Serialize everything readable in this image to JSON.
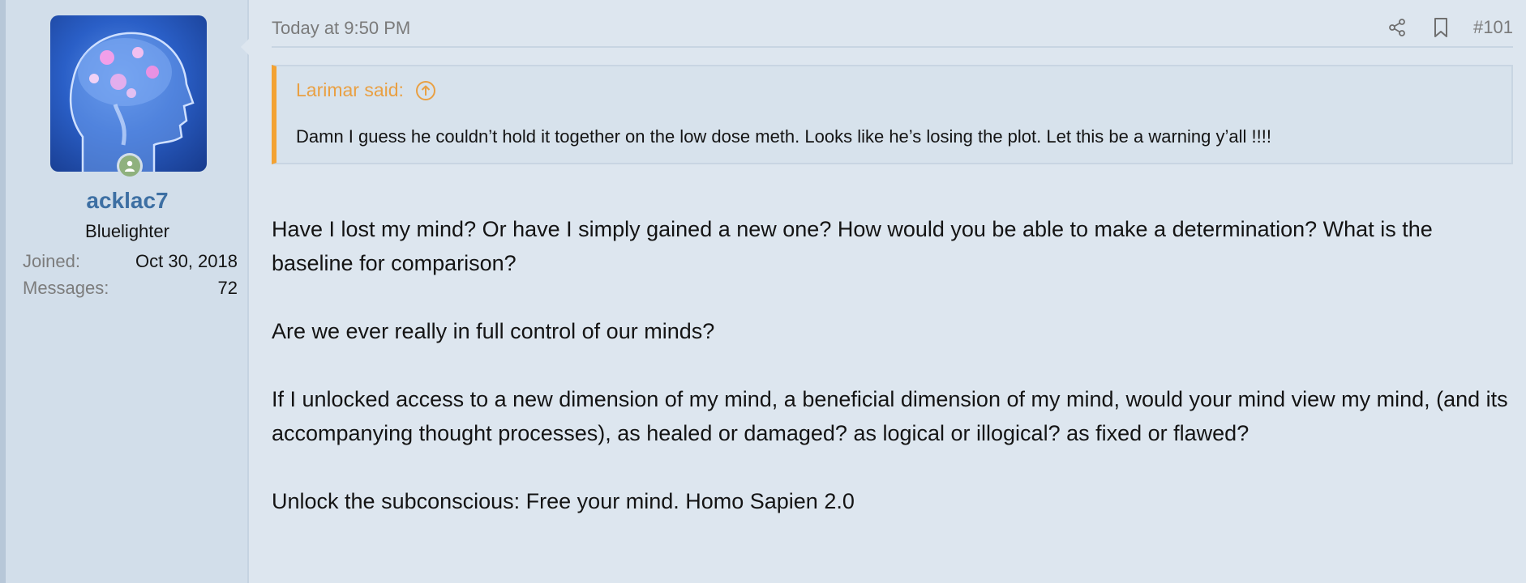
{
  "user": {
    "name": "acklac7",
    "title": "Bluelighter",
    "stats": [
      {
        "key": "Joined:",
        "value": "Oct 30, 2018"
      },
      {
        "key": "Messages:",
        "value": "72"
      }
    ],
    "avatar_icon": "brain-avatar-icon",
    "online_icon": "user-online-icon"
  },
  "post": {
    "date": "Today at 9:50 PM",
    "number": "#101",
    "share_icon": "share-icon",
    "bookmark_icon": "bookmark-icon"
  },
  "quote": {
    "author": "Larimar said:",
    "text": "Damn I guess he couldn’t hold it together on the low dose meth. Looks like he’s losing the plot. Let this be a warning y’all !!!!",
    "accent_color": "#f3a232"
  },
  "message": {
    "paragraphs": [
      "Have I lost my mind? Or have I simply gained a new one? How would you be able to make a determination? What is the baseline for comparison?",
      "Are we ever really in full control of our minds?",
      "If I unlocked access to a new dimension of my mind, a beneficial dimension of my mind, would your mind view my mind, (and its accompanying thought processes), as healed or damaged? as logical or illogical? as fixed or flawed?",
      "Unlock the subconscious: Free your mind. Homo Sapien 2.0"
    ]
  },
  "colors": {
    "username": "#3d6fa3",
    "background": "#dde6ef",
    "sidebar": "#d2deea"
  }
}
